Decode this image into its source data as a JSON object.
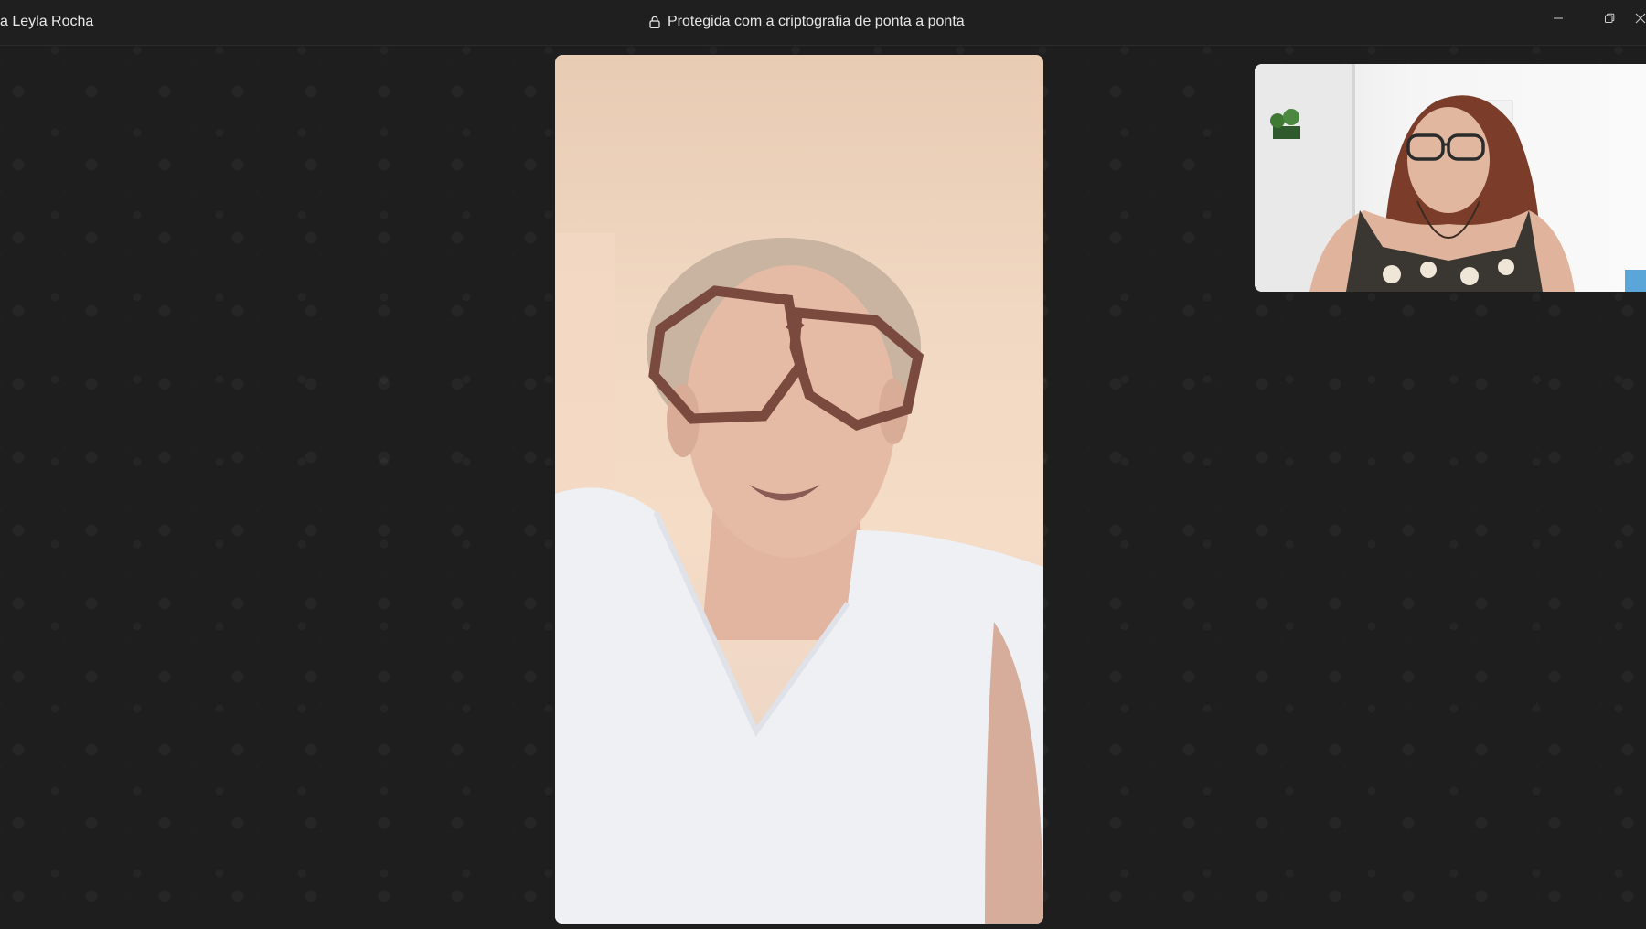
{
  "window": {
    "caller_name": "a Leyla Rocha",
    "encryption_text": "Protegida com a criptografia de ponta a ponta"
  },
  "icons": {
    "lock": "lock-icon",
    "minimize": "minimize-icon",
    "restore": "restore-icon"
  },
  "colors": {
    "background": "#1e1e1e",
    "titlebar": "#1f1f1f",
    "text": "#e6e6e6"
  }
}
